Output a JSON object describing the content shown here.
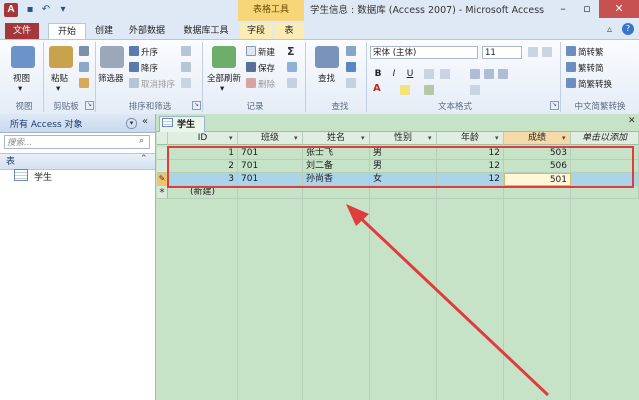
{
  "titlebar": {
    "app_icon": "A",
    "context_group": "表格工具",
    "title": "学生信息 : 数据库 (Access 2007) - Microsoft Access"
  },
  "tabs": {
    "file": "文件",
    "home": "开始",
    "create": "创建",
    "external": "外部数据",
    "dbtools": "数据库工具",
    "fields": "字段",
    "table": "表"
  },
  "ribbon": {
    "views": {
      "view": "视图",
      "label": "视图"
    },
    "clipboard": {
      "paste": "粘贴",
      "label": "剪贴板"
    },
    "sort": {
      "filter": "筛选器",
      "asc": "升序",
      "desc": "降序",
      "remove": "取消排序",
      "label": "排序和筛选"
    },
    "records": {
      "refresh": "全部刷新",
      "new": "新建",
      "save": "保存",
      "delete": "删除",
      "label": "记录"
    },
    "find": {
      "find": "查找",
      "label": "查找"
    },
    "text": {
      "font": "宋体 (主体)",
      "size": "11",
      "bold": "B",
      "italic": "I",
      "underline": "U",
      "label": "文本格式"
    },
    "chinese": {
      "to_trad": "简转繁",
      "to_simp": "繁转简",
      "convert": "简繁转换",
      "label": "中文简繁转换"
    }
  },
  "nav": {
    "header": "所有 Access 对象",
    "search_placeholder": "搜索...",
    "group": "表",
    "items": [
      {
        "label": "学生"
      }
    ]
  },
  "doc": {
    "tab_label": "学生",
    "columns": [
      "ID",
      "班级",
      "姓名",
      "性别",
      "年龄",
      "成绩",
      "单击以添加"
    ],
    "rows": [
      {
        "id": "1",
        "class": "701",
        "name": "张士飞",
        "gender": "男",
        "age": "12",
        "score": "503"
      },
      {
        "id": "2",
        "class": "701",
        "name": "刘二备",
        "gender": "男",
        "age": "12",
        "score": "506"
      },
      {
        "id": "3",
        "class": "701",
        "name": "孙尚香",
        "gender": "女",
        "age": "12",
        "score": "501"
      }
    ],
    "new_row": "(新建)",
    "new_marker": "*"
  },
  "colors": {
    "accent": "#a4373a",
    "annotation": "#e03c3c",
    "grid_bg": "#c6e3c8",
    "selected_row": "#aad4ea"
  },
  "icons": [
    "access-logo-icon",
    "save-icon",
    "undo-icon",
    "view-icon",
    "paste-icon",
    "cut-icon",
    "copy-icon",
    "format-painter-icon",
    "filter-icon",
    "sort-asc-icon",
    "sort-desc-icon",
    "refresh-icon",
    "new-record-icon",
    "save-record-icon",
    "delete-record-icon",
    "sum-icon",
    "spelling-icon",
    "more-icon",
    "find-icon",
    "replace-icon",
    "goto-icon",
    "select-icon",
    "table-icon",
    "pencil-icon"
  ]
}
